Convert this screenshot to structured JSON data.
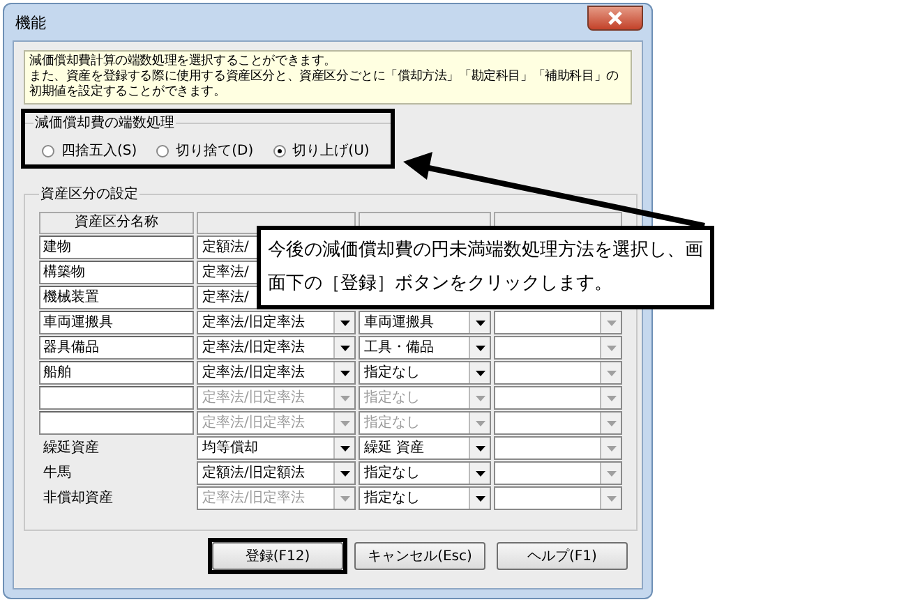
{
  "window": {
    "title": "機能"
  },
  "info": [
    "減価償却費計算の端数処理を選択することができます。",
    "また、資産を登録する際に使用する資産区分と、資産区分ごとに「償却方法」「勘定科目」「補助科目」の",
    "初期値を設定することができます。"
  ],
  "rounding": {
    "title": "減価償却費の端数処理",
    "highlighted": true,
    "options": [
      {
        "label": "四捨五入(S)",
        "selected": false
      },
      {
        "label": "切り捨て(D)",
        "selected": false
      },
      {
        "label": "切り上げ(U)",
        "selected": true
      }
    ]
  },
  "assets": {
    "title": "資産区分の設定",
    "columns": [
      "資産区分名称"
    ],
    "rows": [
      {
        "name": "建物",
        "editable": true,
        "method": {
          "value": "定額法/",
          "disabled": false
        }
      },
      {
        "name": "構築物",
        "editable": true,
        "method": {
          "value": "定率法/",
          "disabled": false
        }
      },
      {
        "name": "機械装置",
        "editable": true,
        "method": {
          "value": "定率法/",
          "disabled": false
        }
      },
      {
        "name": "車両運搬具",
        "editable": true,
        "method": {
          "value": "定率法/旧定率法",
          "disabled": false
        },
        "account": {
          "value": "車両運搬具",
          "disabled": false
        }
      },
      {
        "name": "器具備品",
        "editable": true,
        "method": {
          "value": "定率法/旧定率法",
          "disabled": false
        },
        "account": {
          "value": "工具・備品",
          "disabled": false
        }
      },
      {
        "name": "船舶",
        "editable": true,
        "method": {
          "value": "定率法/旧定率法",
          "disabled": false
        },
        "account": {
          "value": "指定なし",
          "disabled": false
        }
      },
      {
        "editable": true,
        "method": {
          "value": "定率法/旧定率法",
          "disabled": true
        },
        "account": {
          "value": "指定なし",
          "disabled": true
        }
      },
      {
        "editable": true,
        "method": {
          "value": "定率法/旧定率法",
          "disabled": true
        },
        "account": {
          "value": "指定なし",
          "disabled": true
        }
      },
      {
        "name": "繰延資産",
        "editable": false,
        "method": {
          "value": "均等償却",
          "disabled": false
        },
        "account": {
          "value": "繰延 資産",
          "disabled": false
        }
      },
      {
        "name": "牛馬",
        "editable": false,
        "method": {
          "value": "定額法/旧定額法",
          "disabled": false
        },
        "account": {
          "value": "指定なし",
          "disabled": false
        }
      },
      {
        "name": "非償却資産",
        "editable": false,
        "method": {
          "value": "定率法/旧定率法",
          "disabled": true
        },
        "account": {
          "value": "指定なし",
          "disabled": false
        }
      }
    ]
  },
  "buttons": [
    {
      "label": "登録(F12)",
      "highlighted": true
    },
    {
      "label": "キャンセル(Esc)",
      "highlighted": false
    },
    {
      "label": "ヘルプ(F1)",
      "highlighted": false
    }
  ],
  "callout": "今後の減価償却費の円未満端数処理方法を選択し、画面下の［登録］ボタンをクリックします。"
}
